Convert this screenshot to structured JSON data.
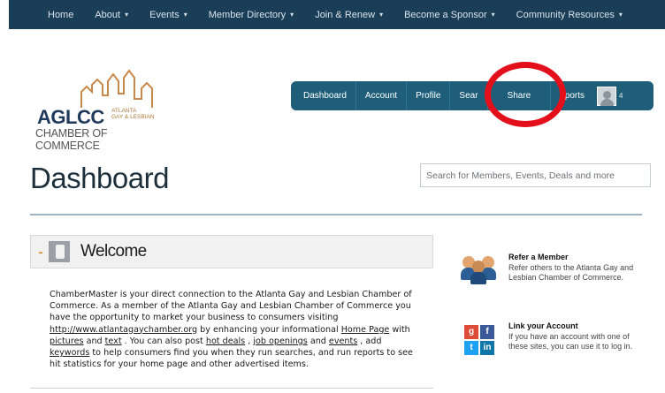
{
  "topnav": {
    "items": [
      {
        "label": "Home",
        "dropdown": false
      },
      {
        "label": "About",
        "dropdown": true
      },
      {
        "label": "Events",
        "dropdown": true
      },
      {
        "label": "Member Directory",
        "dropdown": true
      },
      {
        "label": "Join & Renew",
        "dropdown": true
      },
      {
        "label": "Become a Sponsor",
        "dropdown": true
      },
      {
        "label": "Community Resources",
        "dropdown": true
      }
    ],
    "caret": "▾"
  },
  "logo": {
    "short": "AGLCC",
    "small_line1": "ATLANTA",
    "small_line2": "GAY & LESBIAN",
    "full": "CHAMBER OF COMMERCE"
  },
  "tabs": [
    "Dashboard",
    "Account",
    "Profile",
    "Sear",
    "Share",
    "eports"
  ],
  "user_count": "4",
  "page_title": "Dashboard",
  "search": {
    "placeholder": "Search for Members, Events, Deals and more"
  },
  "welcome": {
    "dash": "-",
    "heading": "Welcome",
    "text": {
      "p1": "ChamberMaster is your direct connection to the Atlanta Gay and Lesbian Chamber of Commerce. As a member of the Atlanta Gay and Lesbian Chamber of Commerce you have the opportunity to market your business to consumers visiting ",
      "link_url": "http://www.atlantagaychamber.org",
      "p2": " by enhancing your informational ",
      "link_home": "Home Page",
      "p3": " with ",
      "link_pictures": "pictures",
      "p4": " and ",
      "link_text": "text",
      "p5": " . You can also post ",
      "link_deals": "hot deals",
      "p6": " , ",
      "link_jobs": "job openings",
      "p7": " and ",
      "link_events": "events",
      "p8": " , add ",
      "link_keywords": "keywords",
      "p9": " to help consumers find you when they run searches, and run reports to see hit statistics for your home page and other advertised items."
    }
  },
  "sidebar": {
    "refer": {
      "title": "Refer a Member",
      "desc": "Refer others to the Atlanta Gay and Lesbian Chamber of Commerce."
    },
    "link": {
      "title": "Link your Account",
      "desc": "If you have an account with one of these sites, you can use it to log in."
    },
    "colors": {
      "google": "#dd4b39",
      "facebook": "#3b5998",
      "twitter": "#1da1f2",
      "linkedin": "#0e76a8"
    }
  }
}
